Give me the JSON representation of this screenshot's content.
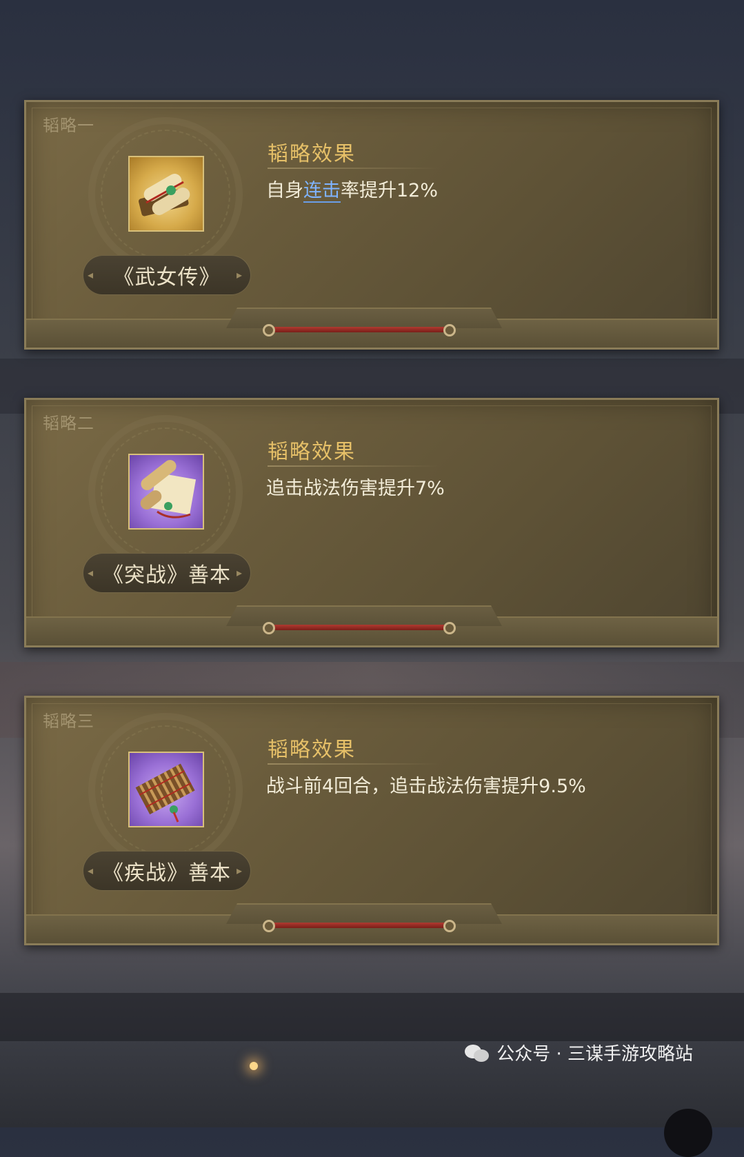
{
  "panels": [
    {
      "tag": "韬略一",
      "item_name": "《武女传》",
      "effect_title": "韬略效果",
      "effect": {
        "pre": "自身",
        "highlight": "连击",
        "post": "率提升12%"
      }
    },
    {
      "tag": "韬略二",
      "item_name": "《突战》善本",
      "effect_title": "韬略效果",
      "effect": {
        "pre": "追击战法伤害提升7%",
        "highlight": "",
        "post": ""
      }
    },
    {
      "tag": "韬略三",
      "item_name": "《疾战》善本",
      "effect_title": "韬略效果",
      "effect": {
        "pre": "战斗前4回合，追击战法伤害提升9.5%",
        "highlight": "",
        "post": ""
      }
    }
  ],
  "watermark": {
    "text": "公众号 · 三谋手游攻略站"
  },
  "colors": {
    "effect_title": "#e6c068",
    "highlight": "#7fb4ff",
    "cord": "#b03a30"
  },
  "icons": [
    "scroll-icon",
    "scroll-icon",
    "bamboo-book-icon",
    "wechat-icon"
  ]
}
